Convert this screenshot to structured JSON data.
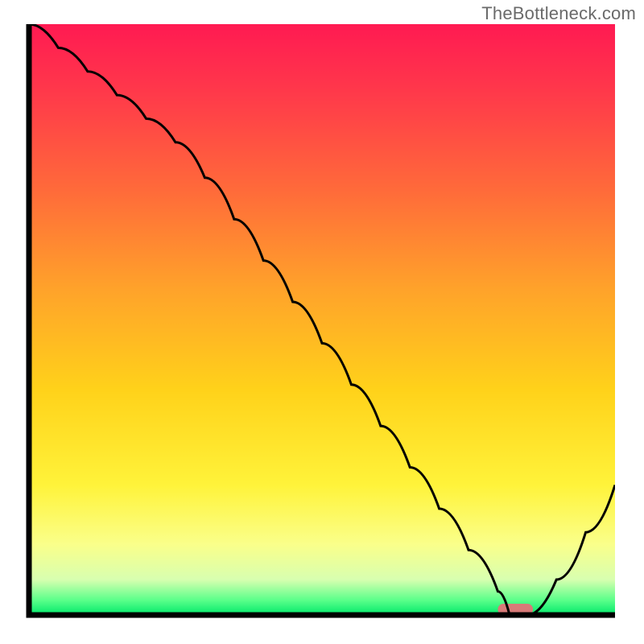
{
  "watermark": "TheBottleneck.com",
  "chart_data": {
    "type": "line",
    "title": "",
    "xlabel": "",
    "ylabel": "",
    "xlim": [
      0,
      100
    ],
    "ylim": [
      0,
      100
    ],
    "x": [
      0,
      5,
      10,
      15,
      20,
      25,
      30,
      35,
      40,
      45,
      50,
      55,
      60,
      65,
      70,
      75,
      80,
      82,
      85,
      90,
      95,
      100
    ],
    "values": [
      100,
      96,
      92,
      88,
      84,
      80,
      74,
      67,
      60,
      53,
      46,
      39,
      32,
      25,
      18,
      11,
      4,
      0,
      0,
      6,
      14,
      22
    ],
    "optimal_range_x": [
      80,
      86
    ],
    "gradient_stops": [
      {
        "offset": 0.0,
        "color": "#ff1a52"
      },
      {
        "offset": 0.12,
        "color": "#ff3a4a"
      },
      {
        "offset": 0.28,
        "color": "#ff6a3a"
      },
      {
        "offset": 0.45,
        "color": "#ffa32a"
      },
      {
        "offset": 0.62,
        "color": "#ffd21a"
      },
      {
        "offset": 0.78,
        "color": "#fff33a"
      },
      {
        "offset": 0.88,
        "color": "#faff8a"
      },
      {
        "offset": 0.94,
        "color": "#d8ffb0"
      },
      {
        "offset": 0.975,
        "color": "#5aff8a"
      },
      {
        "offset": 1.0,
        "color": "#00e86a"
      }
    ],
    "marker_color": "#d87a78",
    "line_color": "#000000",
    "frame_color": "#000000"
  }
}
